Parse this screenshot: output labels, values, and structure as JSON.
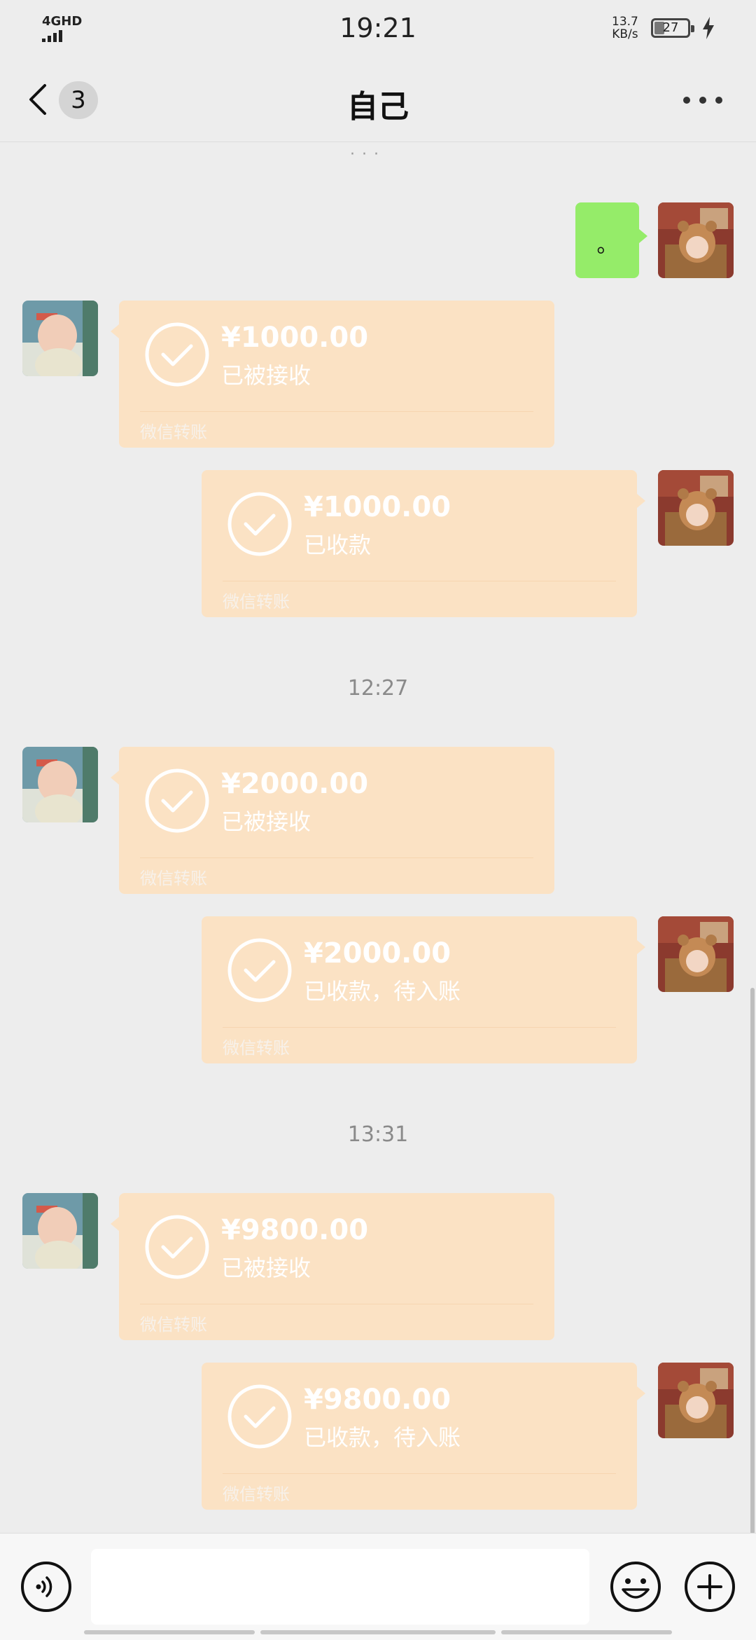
{
  "status_bar": {
    "network": "4GHD",
    "time": "19:21",
    "speed_value": "13.7",
    "speed_unit": "KB/s",
    "battery": "27",
    "battery_level_percent": 27,
    "charging_icon": "lightning-icon"
  },
  "header": {
    "back_icon": "chevron-left-icon",
    "unread_count": "3",
    "title": "自己",
    "more_icon": "more-dots-icon"
  },
  "chat": {
    "load_more_icon": "loading-dots-icon",
    "first_message": "。",
    "blocks": [
      {
        "time": "",
        "received": {
          "amount": "¥1000.00",
          "status": "已被接收",
          "brand": "微信转账"
        },
        "sent": {
          "amount": "¥1000.00",
          "status": "已收款",
          "brand": "微信转账"
        }
      },
      {
        "time": "12:27",
        "received": {
          "amount": "¥2000.00",
          "status": "已被接收",
          "brand": "微信转账"
        },
        "sent": {
          "amount": "¥2000.00",
          "status": "已收款，待入账",
          "brand": "微信转账"
        }
      },
      {
        "time": "13:31",
        "received": {
          "amount": "¥9800.00",
          "status": "已被接收",
          "brand": "微信转账"
        },
        "sent": {
          "amount": "¥9800.00",
          "status": "已收款，待入账",
          "brand": "微信转账"
        }
      }
    ]
  },
  "input_bar": {
    "voice_icon": "voice-icon",
    "message_value": "",
    "emoji_icon": "emoji-icon",
    "plus_icon": "plus-icon"
  },
  "colors": {
    "background": "#ededed",
    "transfer_bubble": "#fbe2c4",
    "text_bubble": "#95ec69"
  }
}
